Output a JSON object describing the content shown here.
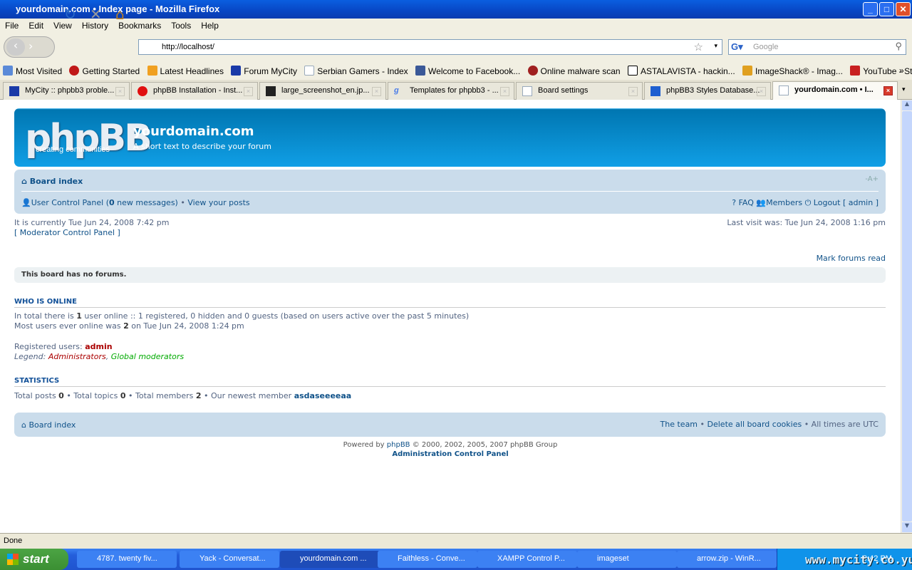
{
  "window": {
    "title": "yourdomain.com • Index page - Mozilla Firefox",
    "min": "_",
    "max": "□",
    "close": "✕"
  },
  "menu": [
    "File",
    "Edit",
    "View",
    "History",
    "Bookmarks",
    "Tools",
    "Help"
  ],
  "nav": {
    "url": "http://localhost/",
    "search_placeholder": "Google"
  },
  "bookmarks": [
    "Most Visited",
    "Getting Started",
    "Latest Headlines",
    "Forum MyCity",
    "Serbian Gamers - Index",
    "Welcome to Facebook...",
    "Online malware scan",
    "ASTALAVISTA - hackin...",
    "ImageShack® - Imag...",
    "YouTube - Stephen Ly..."
  ],
  "bookmarks_more": "»",
  "tabs": [
    {
      "label": "MyCity :: phpbb3 proble...",
      "color": "#1a3aa8"
    },
    {
      "label": "phpBB Installation - Inst...",
      "color": "#e01010"
    },
    {
      "label": "large_screenshot_en.jp...",
      "color": "#222"
    },
    {
      "label": "Templates for phpbb3 - ...",
      "color": "#4a7ce8"
    },
    {
      "label": "Board settings",
      "color": "#dde6f3"
    },
    {
      "label": "phpBB3 Styles Database...",
      "color": "#1e5fd0"
    },
    {
      "label": "yourdomain.com • I...",
      "color": "#dde6f3"
    }
  ],
  "forum": {
    "site_name": "yourdomain.com",
    "site_desc": "A short text to describe your forum",
    "logo": "phpBB",
    "logo_sub": "creating communities",
    "board_index": "Board index",
    "font_size": "-A+",
    "ucp": "User Control Panel (",
    "new_count": "0",
    "new_messages": " new messages)",
    "sep": " • ",
    "view_posts": "View your posts",
    "faq": "FAQ",
    "members": "Members",
    "logout": "Logout [ admin ]",
    "current_time": "It is currently Tue Jun 24, 2008 7:42 pm",
    "last_visit": "Last visit was: Tue Jun 24, 2008 1:16 pm",
    "mcp": "[ Moderator Control Panel ]",
    "mark_read": "Mark forums read",
    "no_forums": "This board has no forums.",
    "who_online_title": "WHO IS ONLINE",
    "online_1a": "In total there is ",
    "online_1b": "1",
    "online_1c": " user online :: 1 registered, 0 hidden and 0 guests (based on users active over the past 5 minutes)",
    "online_2a": "Most users ever online was ",
    "online_2b": "2",
    "online_2c": " on Tue Jun 24, 2008 1:24 pm",
    "registered_label": "Registered users: ",
    "registered_user": "admin",
    "legend_label": "Legend: ",
    "legend_admin": "Administrators",
    "legend_comma": ", ",
    "legend_mod": "Global moderators",
    "stats_title": "STATISTICS",
    "stats": {
      "a": "Total posts ",
      "posts": "0",
      "b": " • Total topics ",
      "topics": "0",
      "c": " • Total members ",
      "members": "2",
      "d": " • Our newest member ",
      "newest": "asdaseeeeaa"
    },
    "footer_board_index": "Board index",
    "team": "The team",
    "delete_cookies": "Delete all board cookies",
    "times": " • All times are UTC",
    "powered_a": "Powered by ",
    "powered_link": "phpBB",
    "powered_b": " © 2000, 2002, 2005, 2007 phpBB Group",
    "acp": "Administration Control Panel"
  },
  "status": "Done",
  "taskbar": {
    "start": "start",
    "tasks": [
      "4787. twenty fiv...",
      "Yack - Conversat...",
      "yourdomain.com ...",
      "Faithless - Conve...",
      "XAMPP Control P...",
      "imageset",
      "arrow.zip - WinR..."
    ],
    "clock": "9:42 PM",
    "watermark": "www.mycity.co.yu"
  }
}
